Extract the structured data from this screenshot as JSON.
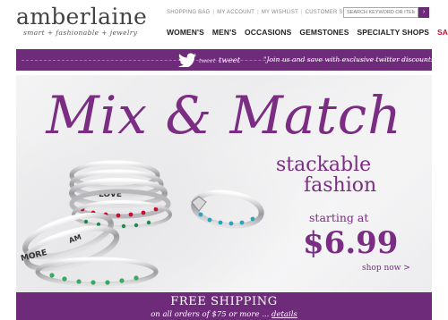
{
  "brand": {
    "name": "amberlaine",
    "tagline": "smart + fashionable + jewelry"
  },
  "utility_nav": {
    "links": [
      "SHOPPING BAG",
      "MY ACCOUNT",
      "MY WISHLIST",
      "CUSTOMER SERVICE"
    ],
    "search_placeholder": "SEARCH KEYWORD OR ITEM #"
  },
  "main_nav": {
    "items": [
      "WOMEN'S",
      "MEN'S",
      "OCCASIONS",
      "GEMSTONES",
      "SPECIALTY SHOPS"
    ],
    "sale": "SALE"
  },
  "twitter": {
    "tweet_small": "tweet",
    "tweet_large": "tweet",
    "message": "\"Join us and save with exclusive twitter discounts!\""
  },
  "hero": {
    "title": "Mix & Match",
    "subtitle_line1": "stackable",
    "subtitle_line2": "fashion",
    "starting_at": "starting at",
    "price": "$6.99",
    "cta": "shop now >",
    "ring_engravings": [
      "LOVE",
      "MORE",
      "AM"
    ]
  },
  "shipping": {
    "title": "FREE SHIPPING",
    "subtitle": "on all orders of $75 or more",
    "details_link": "details"
  },
  "colors": {
    "brand_purple": "#6e2b7a",
    "headline_purple": "#7a2d82",
    "sale_red": "#c8102e"
  }
}
